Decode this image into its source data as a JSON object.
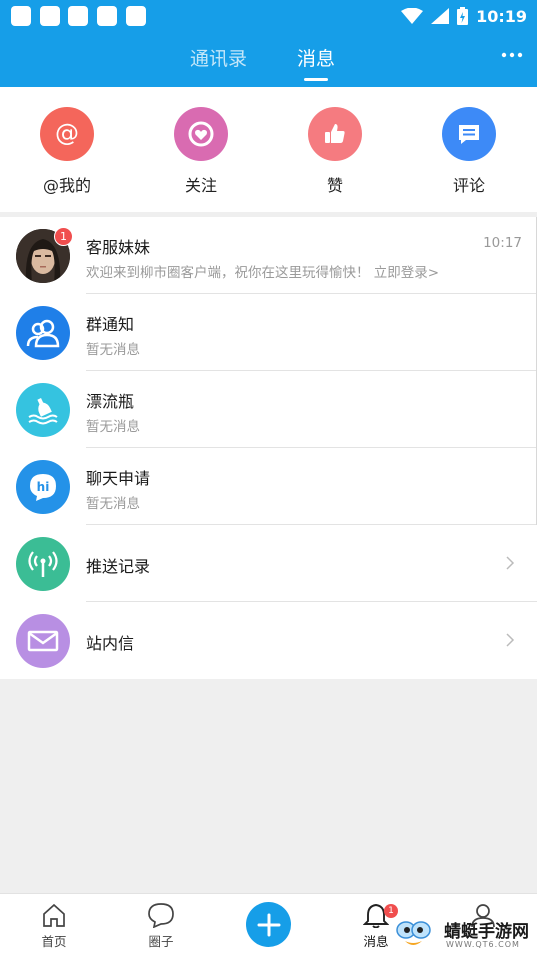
{
  "status_bar": {
    "time": "10:19"
  },
  "header": {
    "tabs": [
      {
        "label": "通讯录",
        "active": false
      },
      {
        "label": "消息",
        "active": true
      }
    ],
    "more_icon": "more-dots-icon"
  },
  "quick_actions": [
    {
      "label": "@我的",
      "icon": "at-icon",
      "color": "#f4665b"
    },
    {
      "label": "关注",
      "icon": "heart-circle-icon",
      "color": "#d96bb1"
    },
    {
      "label": "赞",
      "icon": "thumbs-up-icon",
      "color": "#f57b80"
    },
    {
      "label": "评论",
      "icon": "comment-icon",
      "color": "#3d8af7"
    }
  ],
  "messages": [
    {
      "title": "客服妹妹",
      "subtitle": "欢迎来到柳市圈客户端，祝你在这里玩得愉快！ 立即登录>",
      "time": "10:17",
      "badge": "1",
      "avatar": "user-avatar"
    },
    {
      "title": "群通知",
      "subtitle": "暂无消息",
      "icon": "group-icon",
      "color": "#1f7fe8"
    },
    {
      "title": "漂流瓶",
      "subtitle": "暂无消息",
      "icon": "bottle-icon",
      "color": "#35c3e0"
    },
    {
      "title": "聊天申请",
      "subtitle": "暂无消息",
      "icon": "hi-chat-icon",
      "color": "#2492e8"
    },
    {
      "title": "推送记录",
      "icon": "broadcast-icon",
      "color": "#3bbd95"
    },
    {
      "title": "站内信",
      "icon": "mail-icon",
      "color": "#b88fe3"
    }
  ],
  "bottom_nav": [
    {
      "label": "首页",
      "icon": "home-icon"
    },
    {
      "label": "圈子",
      "icon": "chat-bubble-icon"
    },
    {
      "label": "",
      "icon": "plus-icon"
    },
    {
      "label": "消息",
      "icon": "bell-icon",
      "badge": "1"
    },
    {
      "label": "",
      "icon": "profile-icon"
    }
  ],
  "watermark": {
    "text": "蜻蜓手游网",
    "url": "WWW.QT6.COM"
  }
}
